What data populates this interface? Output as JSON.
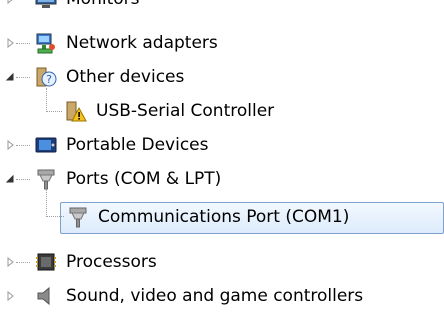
{
  "tree": {
    "items": [
      {
        "label": "Monitors",
        "icon": "monitor-icon",
        "expander": "collapsed"
      },
      {
        "label": "Network adapters",
        "icon": "network-adapter-icon",
        "expander": "collapsed"
      },
      {
        "label": "Other devices",
        "icon": "unknown-device-icon",
        "expander": "expanded"
      },
      {
        "label": "USB-Serial Controller",
        "icon": "warning-device-icon",
        "expander": "none"
      },
      {
        "label": "Portable Devices",
        "icon": "portable-device-icon",
        "expander": "collapsed"
      },
      {
        "label": "Ports (COM & LPT)",
        "icon": "port-icon",
        "expander": "expanded"
      },
      {
        "label": "Communications Port (COM1)",
        "icon": "port-icon",
        "expander": "none",
        "selected": true
      },
      {
        "label": "Processors",
        "icon": "processor-icon",
        "expander": "collapsed"
      },
      {
        "label": "Sound, video and game controllers",
        "icon": "sound-icon",
        "expander": "collapsed"
      }
    ]
  },
  "colors": {
    "selection_border": "#7da2ce",
    "selection_fill": "#dcebfc",
    "text": "#000000"
  }
}
